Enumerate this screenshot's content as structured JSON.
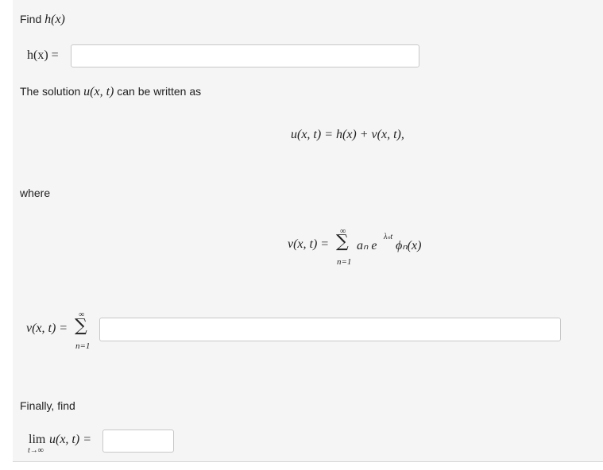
{
  "q1": {
    "text": "Find",
    "func": "h(x)"
  },
  "h_row": {
    "label": "h(x) =",
    "value": "",
    "placeholder": ""
  },
  "solution_text": {
    "before": "The solution",
    "func": "u(x, t)",
    "after": "can be written as"
  },
  "eq1": "u(x, t) = h(x) + v(x, t),",
  "where_label": "where",
  "eq2": {
    "lhs": "v(x, t) =",
    "sum_top": "∞",
    "sum_bottom": "n=1",
    "body": "aₙ e",
    "exponent": "λₙt",
    "tail": "ϕₙ(x)"
  },
  "v_row": {
    "lhs": "v(x, t) =",
    "sum_top": "∞",
    "sum_bottom": "n=1",
    "value": ""
  },
  "finally_label": "Finally, find",
  "limit_row": {
    "lim": "lim",
    "func": "u(x, t) =",
    "sub": "t→∞",
    "value": ""
  }
}
